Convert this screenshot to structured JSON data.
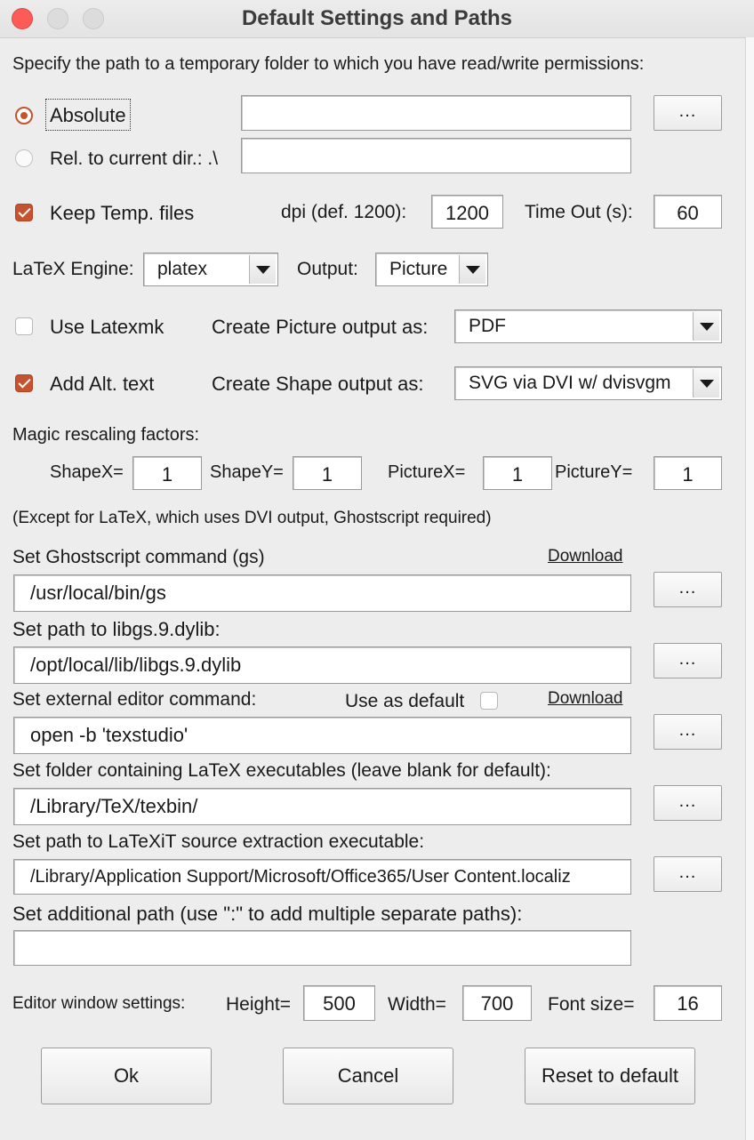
{
  "window": {
    "title": "Default Settings and Paths"
  },
  "temp": {
    "prompt": "Specify the path to a temporary folder to which you have read/write permissions:",
    "absolute_label": "Absolute",
    "absolute_value": "",
    "relative_label": "Rel. to current dir.: .\\",
    "relative_value": "",
    "selected": "absolute",
    "browse_label": "..."
  },
  "options": {
    "keep_temp_label": "Keep Temp. files",
    "keep_temp_checked": true,
    "dpi_label": "dpi (def. 1200):",
    "dpi_value": "1200",
    "timeout_label": "Time Out (s):",
    "timeout_value": "60",
    "engine_label": "LaTeX Engine:",
    "engine_value": "platex",
    "output_label": "Output:",
    "output_value": "Picture",
    "latexmk_label": "Use Latexmk",
    "latexmk_checked": false,
    "picture_output_label": "Create Picture output as:",
    "picture_output_value": "PDF",
    "alt_text_label": "Add Alt. text",
    "alt_text_checked": true,
    "shape_output_label": "Create Shape output as:",
    "shape_output_value": "SVG via DVI w/ dvisvgm"
  },
  "rescale": {
    "title": "Magic rescaling factors:",
    "shapex_label": "ShapeX=",
    "shapex_value": "1",
    "shapey_label": "ShapeY=",
    "shapey_value": "1",
    "picturex_label": "PictureX=",
    "picturex_value": "1",
    "picturey_label": "PictureY=",
    "picturey_value": "1",
    "note": "(Except for LaTeX, which uses DVI output, Ghostscript required)"
  },
  "paths": {
    "gs_label": "Set Ghostscript command (gs)",
    "gs_download": "Download",
    "gs_value": "/usr/local/bin/gs",
    "libgs_label": "Set path to libgs.9.dylib:",
    "libgs_value": "/opt/local/lib/libgs.9.dylib",
    "editor_label": "Set external editor command:",
    "editor_default_label": "Use as default",
    "editor_default_checked": false,
    "editor_download": "Download",
    "editor_value": "open -b 'texstudio'",
    "latex_folder_label": "Set folder containing LaTeX executables (leave blank for default):",
    "latex_folder_value": "/Library/TeX/texbin/",
    "latexit_label": "Set path to LaTeXiT source extraction executable:",
    "latexit_value": "/Library/Application Support/Microsoft/Office365/User Content.localiz",
    "additional_label": "Set additional path (use \":\" to add multiple separate paths):",
    "additional_value": ""
  },
  "editor_window": {
    "label": "Editor window settings:",
    "height_label": "Height=",
    "height_value": "500",
    "width_label": "Width=",
    "width_value": "700",
    "fontsize_label": "Font size=",
    "fontsize_value": "16"
  },
  "buttons": {
    "ok": "Ok",
    "cancel": "Cancel",
    "reset": "Reset to default"
  },
  "colors": {
    "accent": "#c6532f",
    "close_light": "#fc5b57",
    "background": "#ededed"
  }
}
